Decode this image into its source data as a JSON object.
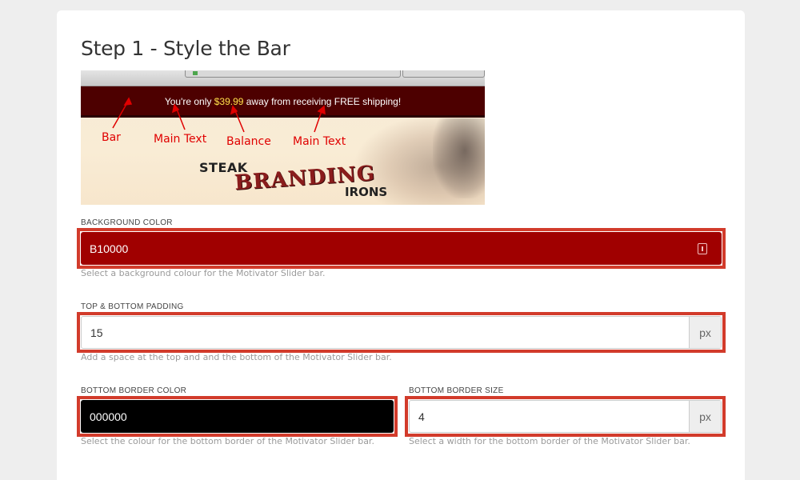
{
  "step": {
    "title": "Step 1 - Style the Bar"
  },
  "preview": {
    "bar_text_before": "You're only ",
    "bar_balance": "$39.99",
    "bar_text_after": " away from receiving FREE shipping!",
    "annotations": {
      "bar": "Bar",
      "main_text_1": "Main Text",
      "balance": "Balance",
      "main_text_2": "Main Text"
    },
    "logo": {
      "line1": "STEAK",
      "line2": "BRANDING",
      "line3": "IRONS"
    }
  },
  "fields": {
    "background_color": {
      "label": "BACKGROUND COLOR",
      "value": "B10000",
      "help": "Select a background colour for the Motivator Slider bar.",
      "color": "#a00000"
    },
    "padding": {
      "label": "TOP & BOTTOM PADDING",
      "value": "15",
      "suffix": "px",
      "help": "Add a space at the top and and the bottom of the Motivator Slider bar."
    },
    "border_color": {
      "label": "BOTTOM BORDER COLOR",
      "value": "000000",
      "help": "Select the colour for the bottom border of the Motivator Slider bar.",
      "color": "#000000"
    },
    "border_size": {
      "label": "BOTTOM BORDER SIZE",
      "value": "4",
      "suffix": "px",
      "help": "Select a width for the bottom border of the Motivator Slider bar."
    }
  },
  "colors": {
    "highlight": "#d23b2b",
    "page_bg": "#eeeeee",
    "card_bg": "#ffffff"
  }
}
